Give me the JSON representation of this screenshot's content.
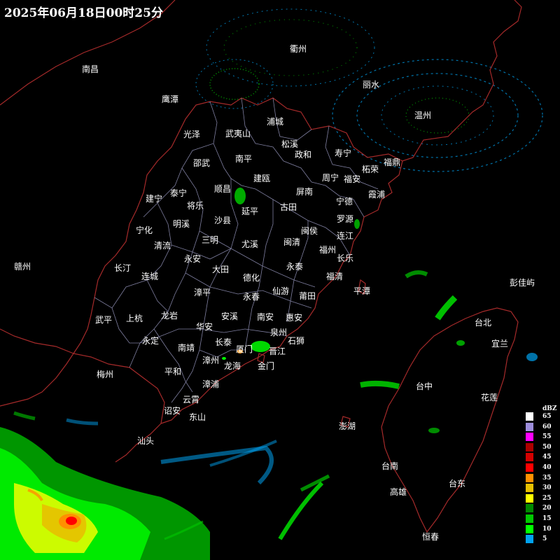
{
  "title": "2025年06月18日00时25分",
  "legend": {
    "unit": "dBZ",
    "levels": [
      {
        "label": "65",
        "color": "#ffffff"
      },
      {
        "label": "60",
        "color": "#9d8ddb"
      },
      {
        "label": "55",
        "color": "#ff00ff"
      },
      {
        "label": "50",
        "color": "#ad0000"
      },
      {
        "label": "45",
        "color": "#d40000"
      },
      {
        "label": "40",
        "color": "#ff0000"
      },
      {
        "label": "35",
        "color": "#ff9000"
      },
      {
        "label": "30",
        "color": "#e7c000"
      },
      {
        "label": "25",
        "color": "#ffff00"
      },
      {
        "label": "20",
        "color": "#008a00"
      },
      {
        "label": "15",
        "color": "#00c800"
      },
      {
        "label": "10",
        "color": "#00ff00"
      },
      {
        "label": "5",
        "color": "#00a2f0"
      }
    ]
  },
  "colors": {
    "background": "#000000",
    "coastline": "#a52a2a",
    "county_border": "#7f7fa0",
    "label": "#ffffff"
  },
  "cities": [
    {
      "name": "南昌"
    },
    {
      "name": "衢州"
    },
    {
      "name": "丽水"
    },
    {
      "name": "鹰潭"
    },
    {
      "name": "温州"
    },
    {
      "name": "光泽"
    },
    {
      "name": "武夷山"
    },
    {
      "name": "浦城"
    },
    {
      "name": "松溪"
    },
    {
      "name": "政和"
    },
    {
      "name": "寿宁"
    },
    {
      "name": "柘荣"
    },
    {
      "name": "福鼎"
    },
    {
      "name": "邵武"
    },
    {
      "name": "南平"
    },
    {
      "name": "建瓯"
    },
    {
      "name": "周宁"
    },
    {
      "name": "福安"
    },
    {
      "name": "霞浦"
    },
    {
      "name": "泰宁"
    },
    {
      "name": "顺昌"
    },
    {
      "name": "建宁"
    },
    {
      "name": "将乐"
    },
    {
      "name": "延平"
    },
    {
      "name": "屏南"
    },
    {
      "name": "古田"
    },
    {
      "name": "宁德"
    },
    {
      "name": "罗源"
    },
    {
      "name": "明溪"
    },
    {
      "name": "沙县"
    },
    {
      "name": "宁化"
    },
    {
      "name": "闽侯"
    },
    {
      "name": "连江"
    },
    {
      "name": "三明"
    },
    {
      "name": "尤溪"
    },
    {
      "name": "闽清"
    },
    {
      "name": "清流"
    },
    {
      "name": "福州"
    },
    {
      "name": "永安"
    },
    {
      "name": "长乐"
    },
    {
      "name": "赣州"
    },
    {
      "name": "长汀"
    },
    {
      "name": "大田"
    },
    {
      "name": "永泰"
    },
    {
      "name": "连城"
    },
    {
      "name": "德化"
    },
    {
      "name": "福清"
    },
    {
      "name": "彭佳屿"
    },
    {
      "name": "漳平"
    },
    {
      "name": "仙游"
    },
    {
      "name": "平潭"
    },
    {
      "name": "永春"
    },
    {
      "name": "莆田"
    },
    {
      "name": "龙岩"
    },
    {
      "name": "武平"
    },
    {
      "name": "上杭"
    },
    {
      "name": "安溪"
    },
    {
      "name": "南安"
    },
    {
      "name": "惠安"
    },
    {
      "name": "台北"
    },
    {
      "name": "华安"
    },
    {
      "name": "泉州"
    },
    {
      "name": "永定"
    },
    {
      "name": "长泰"
    },
    {
      "name": "石狮"
    },
    {
      "name": "宜兰"
    },
    {
      "name": "南靖"
    },
    {
      "name": "厦门"
    },
    {
      "name": "晋江"
    },
    {
      "name": "漳州"
    },
    {
      "name": "平和"
    },
    {
      "name": "龙海"
    },
    {
      "name": "金门"
    },
    {
      "name": "梅州"
    },
    {
      "name": "漳浦"
    },
    {
      "name": "台中"
    },
    {
      "name": "花莲"
    },
    {
      "name": "云霄"
    },
    {
      "name": "诏安"
    },
    {
      "name": "东山"
    },
    {
      "name": "澎湖"
    },
    {
      "name": "汕头"
    },
    {
      "name": "台南"
    },
    {
      "name": "台东"
    },
    {
      "name": "高雄"
    },
    {
      "name": "恒春"
    }
  ]
}
